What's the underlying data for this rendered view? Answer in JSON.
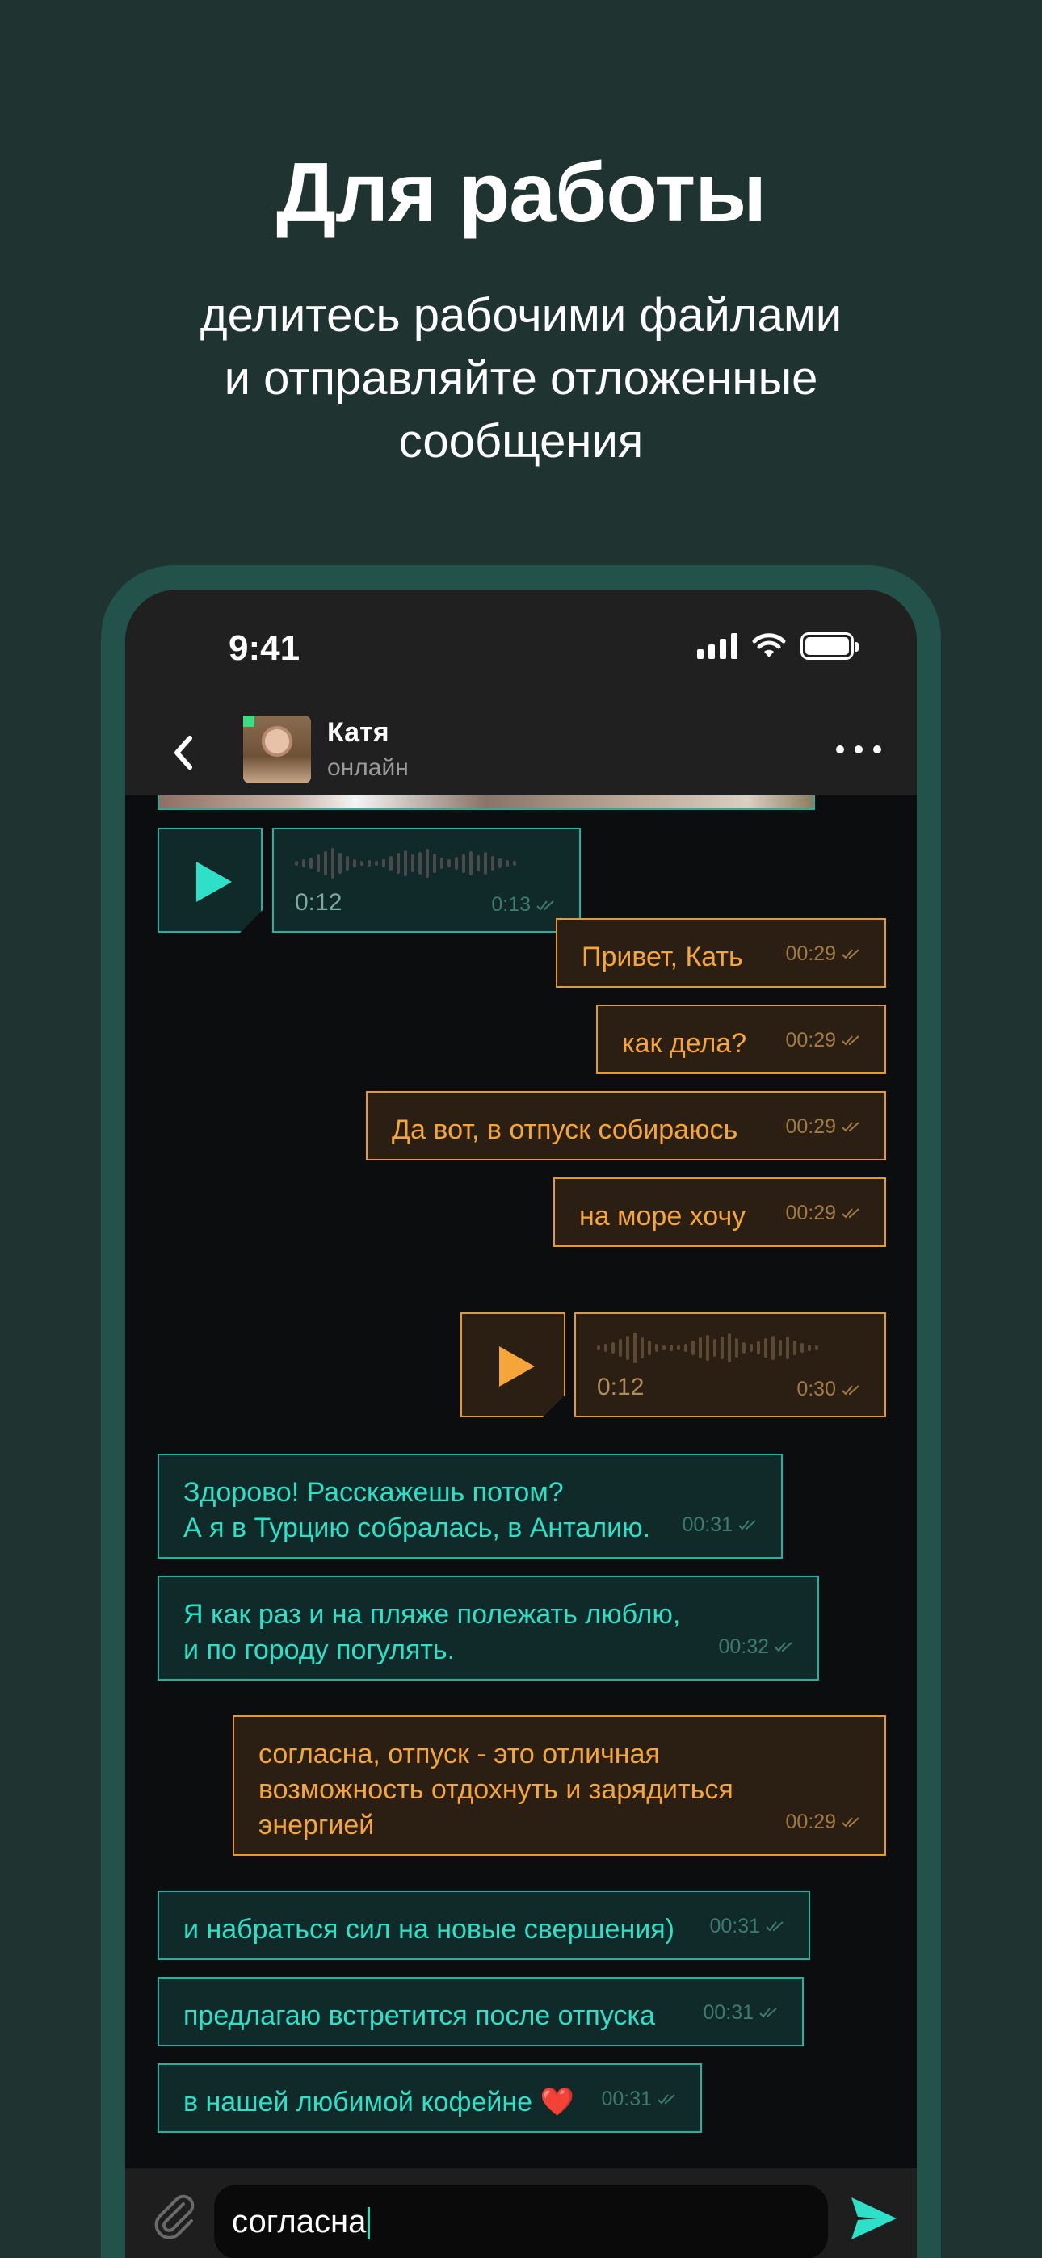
{
  "promo": {
    "title": "Для работы",
    "subtitle_lines": [
      "делитесь рабочими файлами",
      "и отправляйте отложенные",
      "сообщения"
    ]
  },
  "status_bar": {
    "time": "9:41",
    "icons": [
      "signal-icon",
      "wifi-icon",
      "battery-icon"
    ]
  },
  "chat_header": {
    "name": "Катя",
    "status": "онлайн"
  },
  "voice_messages": [
    {
      "direction": "in",
      "duration": "0:12",
      "time": "0:13"
    },
    {
      "direction": "out",
      "duration": "0:12",
      "time": "0:30"
    }
  ],
  "messages": [
    {
      "direction": "out",
      "lines": [
        "Привет, Кать"
      ],
      "time": "00:29"
    },
    {
      "direction": "out",
      "lines": [
        "как дела?"
      ],
      "time": "00:29"
    },
    {
      "direction": "out",
      "lines": [
        "Да вот, в отпуск собираюсь"
      ],
      "time": "00:29"
    },
    {
      "direction": "out",
      "lines": [
        "на море хочу"
      ],
      "time": "00:29"
    },
    {
      "direction": "in",
      "lines": [
        "Здорово! Расскажешь потом?",
        "А я в Турцию собралась, в Анталию."
      ],
      "time": "00:31"
    },
    {
      "direction": "in",
      "lines": [
        "Я как раз и на пляже полежать люблю,",
        "и по городу погулять."
      ],
      "time": "00:32"
    },
    {
      "direction": "out",
      "lines": [
        "согласна, отпуск - это отличная",
        "возможность отдохнуть и зарядиться",
        "энергией"
      ],
      "time": "00:29"
    },
    {
      "direction": "in",
      "lines": [
        "и набраться сил на новые свершения)"
      ],
      "time": "00:31"
    },
    {
      "direction": "in",
      "lines": [
        "предлагаю встретится после отпуска"
      ],
      "time": "00:31"
    },
    {
      "direction": "in",
      "lines": [
        "в нашей любимой кофейне ❤️"
      ],
      "time": "00:31"
    }
  ],
  "composer": {
    "value": "согласна"
  },
  "colors": {
    "background": "#1f3330",
    "incoming": "#1fb3a2",
    "outgoing": "#e49b2c"
  }
}
